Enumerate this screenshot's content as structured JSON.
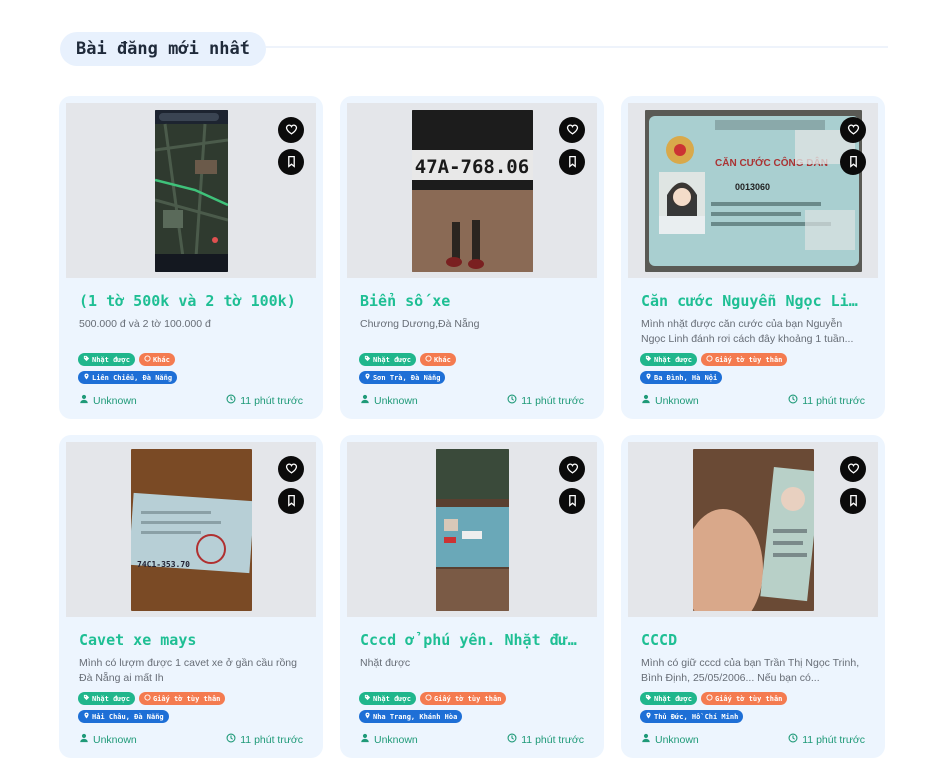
{
  "section": {
    "title": "Bài đăng mới nhất"
  },
  "colors": {
    "accent": "#1fbf94",
    "found_tag": "#20b68c",
    "category_tag": "#f47b50",
    "location_tag": "#1e6fd6",
    "card_bg": "#edf5fe"
  },
  "icons": {
    "like": "heart-icon",
    "save": "bookmark-icon",
    "found": "tag-icon",
    "category": "category-icon",
    "location": "map-pin-icon",
    "author": "user-icon",
    "time": "clock-icon"
  },
  "posts": [
    {
      "title": "(1 tờ 500k và 2 tờ 100k)",
      "description": "500.000 đ và 2 tờ 100.000 đ",
      "status_tag": "Nhặt được",
      "category_tag": "Khác",
      "location_tag": "Liên Chiểu, Đà Nẵng",
      "author": "Unknown",
      "time": "11 phút trước",
      "image": "map-screenshot"
    },
    {
      "title": "Biển số xe",
      "description": "Chương Dương,Đà Nẵng",
      "status_tag": "Nhặt được",
      "category_tag": "Khác",
      "location_tag": "Sơn Trà, Đà Nẵng",
      "author": "Unknown",
      "time": "11 phút trước",
      "image": "license-plate-photo"
    },
    {
      "title": "Căn cước Nguyễn Ngọc Linh",
      "description": "Mình nhặt được căn cước của bạn Nguyễn Ngọc Linh đánh rơi cách đây khoảng 1 tuần...",
      "status_tag": "Nhặt được",
      "category_tag": "Giấy tờ tùy thân",
      "location_tag": "Ba Đình, Hà Nội",
      "author": "Unknown",
      "time": "11 phút trước",
      "image": "id-card-photo"
    },
    {
      "title": "Cavet xe mays",
      "description": "Mình có lượm được 1 cavet xe ở gần cầu rồng Đà Nẵng ai mất Ih",
      "status_tag": "Nhặt được",
      "category_tag": "Giấy tờ tùy thân",
      "location_tag": "Hải Châu, Đà Nẵng",
      "author": "Unknown",
      "time": "11 phút trước",
      "image": "registration-card-photo"
    },
    {
      "title": "Cccd ở phú yên. Nhặt được",
      "description": "Nhặt được",
      "status_tag": "Nhặt được",
      "category_tag": "Giấy tờ tùy thân",
      "location_tag": "Nha Trang, Khánh Hòa",
      "author": "Unknown",
      "time": "11 phút trước",
      "image": "id-card-photo-2"
    },
    {
      "title": "CCCD",
      "description": "Mình có giữ cccd của bạn Trần Thị Ngọc Trinh, Bình Định, 25/05/2006... Nếu bạn có...",
      "status_tag": "Nhặt được",
      "category_tag": "Giấy tờ tùy thân",
      "location_tag": "Thủ Đức, Hồ Chí Minh",
      "author": "Unknown",
      "time": "11 phút trước",
      "image": "id-card-in-hand-photo"
    }
  ]
}
